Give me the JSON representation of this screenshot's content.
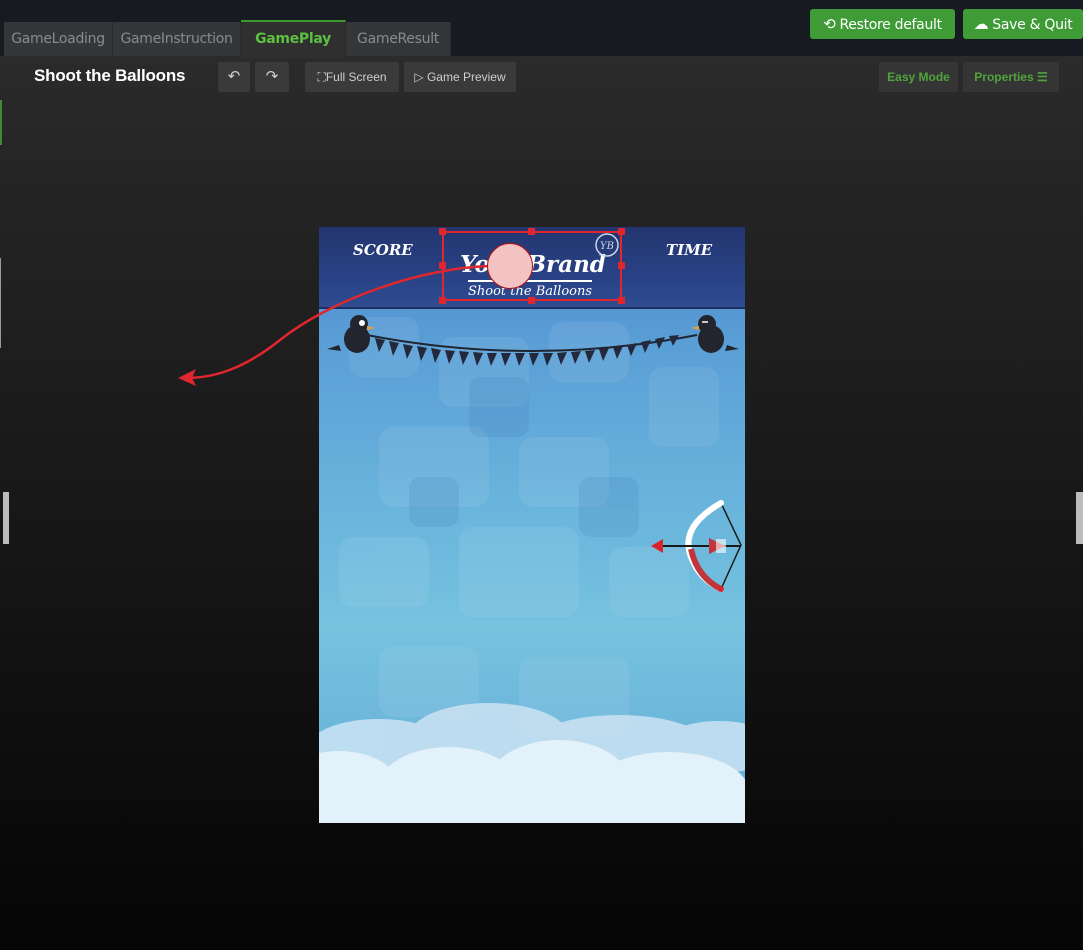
{
  "tabs": [
    "GameLoading",
    "GameInstruction",
    "GamePlay",
    "GameResult"
  ],
  "active_tab": "GamePlay",
  "top_buttons": {
    "restore": "Restore default",
    "save": "Save & Quit"
  },
  "toolbar": {
    "title": "Shoot the Balloons",
    "fullscreen": "Full Screen",
    "preview": "Game Preview",
    "easy_mode": "Easy Mode",
    "properties": "Properties"
  },
  "game": {
    "score_label": "SCORE",
    "time_label": "TIME",
    "brand_main": "Your Brand",
    "brand_sub": "Shoot the Balloons",
    "brand_badge": "YB"
  },
  "colors": {
    "accent": "#3e9b36",
    "active_tab_text": "#5cc042",
    "selection": "#e0262e"
  },
  "icons": [
    "restore-icon",
    "cloud-upload-icon",
    "undo-icon",
    "redo-icon",
    "fullscreen-icon",
    "play-icon",
    "list-icon"
  ]
}
